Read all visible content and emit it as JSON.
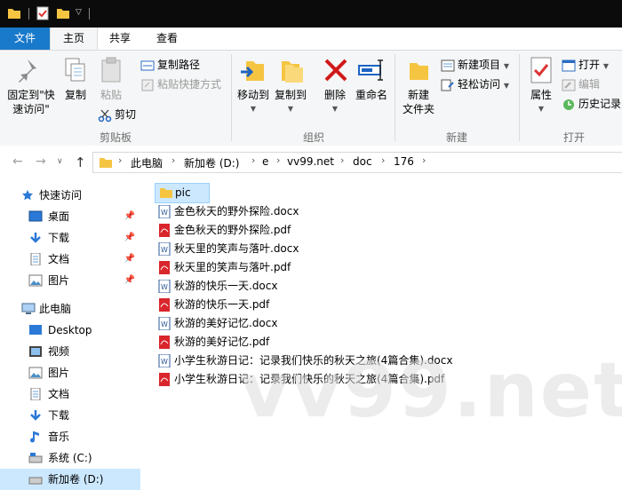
{
  "ribbon_tabs": {
    "file": "文件",
    "home": "主页",
    "share": "共享",
    "view": "查看"
  },
  "clipboard": {
    "pin_label_line1": "固定到\"快",
    "pin_label_line2": "速访问\"",
    "copy": "复制",
    "paste": "粘贴",
    "copy_path": "复制路径",
    "paste_shortcut": "粘贴快捷方式",
    "cut": "剪切",
    "group_label": "剪贴板"
  },
  "organize": {
    "move_to": "移动到",
    "copy_to": "复制到",
    "delete": "删除",
    "rename": "重命名",
    "group_label": "组织"
  },
  "new_group": {
    "new_folder_line1": "新建",
    "new_folder_line2": "文件夹",
    "new_item": "新建项目",
    "easy_access": "轻松访问",
    "group_label": "新建"
  },
  "open_group": {
    "properties": "属性",
    "open": "打开",
    "edit": "编辑",
    "history": "历史记录",
    "group_label": "打开"
  },
  "address": {
    "crumbs": [
      "此电脑",
      "新加卷 (D:)",
      "e",
      "vv99.net",
      "doc",
      "176"
    ]
  },
  "nav": {
    "quick_access": "快速访问",
    "desktop_cn": "桌面",
    "downloads": "下载",
    "documents": "文档",
    "pictures": "图片",
    "this_pc": "此电脑",
    "desktop": "Desktop",
    "videos": "视频",
    "pictures2": "图片",
    "documents2": "文档",
    "downloads2": "下载",
    "music": "音乐",
    "system_c": "系统 (C:)",
    "new_volume_d": "新加卷 (D:)"
  },
  "files": [
    {
      "name": "pic",
      "type": "folder"
    },
    {
      "name": "金色秋天的野外探险.docx",
      "type": "docx"
    },
    {
      "name": "金色秋天的野外探险.pdf",
      "type": "pdf"
    },
    {
      "name": "秋天里的笑声与落叶.docx",
      "type": "docx"
    },
    {
      "name": "秋天里的笑声与落叶.pdf",
      "type": "pdf"
    },
    {
      "name": "秋游的快乐一天.docx",
      "type": "docx"
    },
    {
      "name": "秋游的快乐一天.pdf",
      "type": "pdf"
    },
    {
      "name": "秋游的美好记忆.docx",
      "type": "docx"
    },
    {
      "name": "秋游的美好记忆.pdf",
      "type": "pdf"
    },
    {
      "name": "小学生秋游日记：记录我们快乐的秋天之旅(4篇合集).docx",
      "type": "docx"
    },
    {
      "name": "小学生秋游日记：记录我们快乐的秋天之旅(4篇合集).pdf",
      "type": "pdf"
    }
  ],
  "watermark": "vv99.net",
  "colors": {
    "file_tab": "#1979ca",
    "selection": "#cce8ff",
    "ribbon_bg": "#f5f6f7"
  }
}
